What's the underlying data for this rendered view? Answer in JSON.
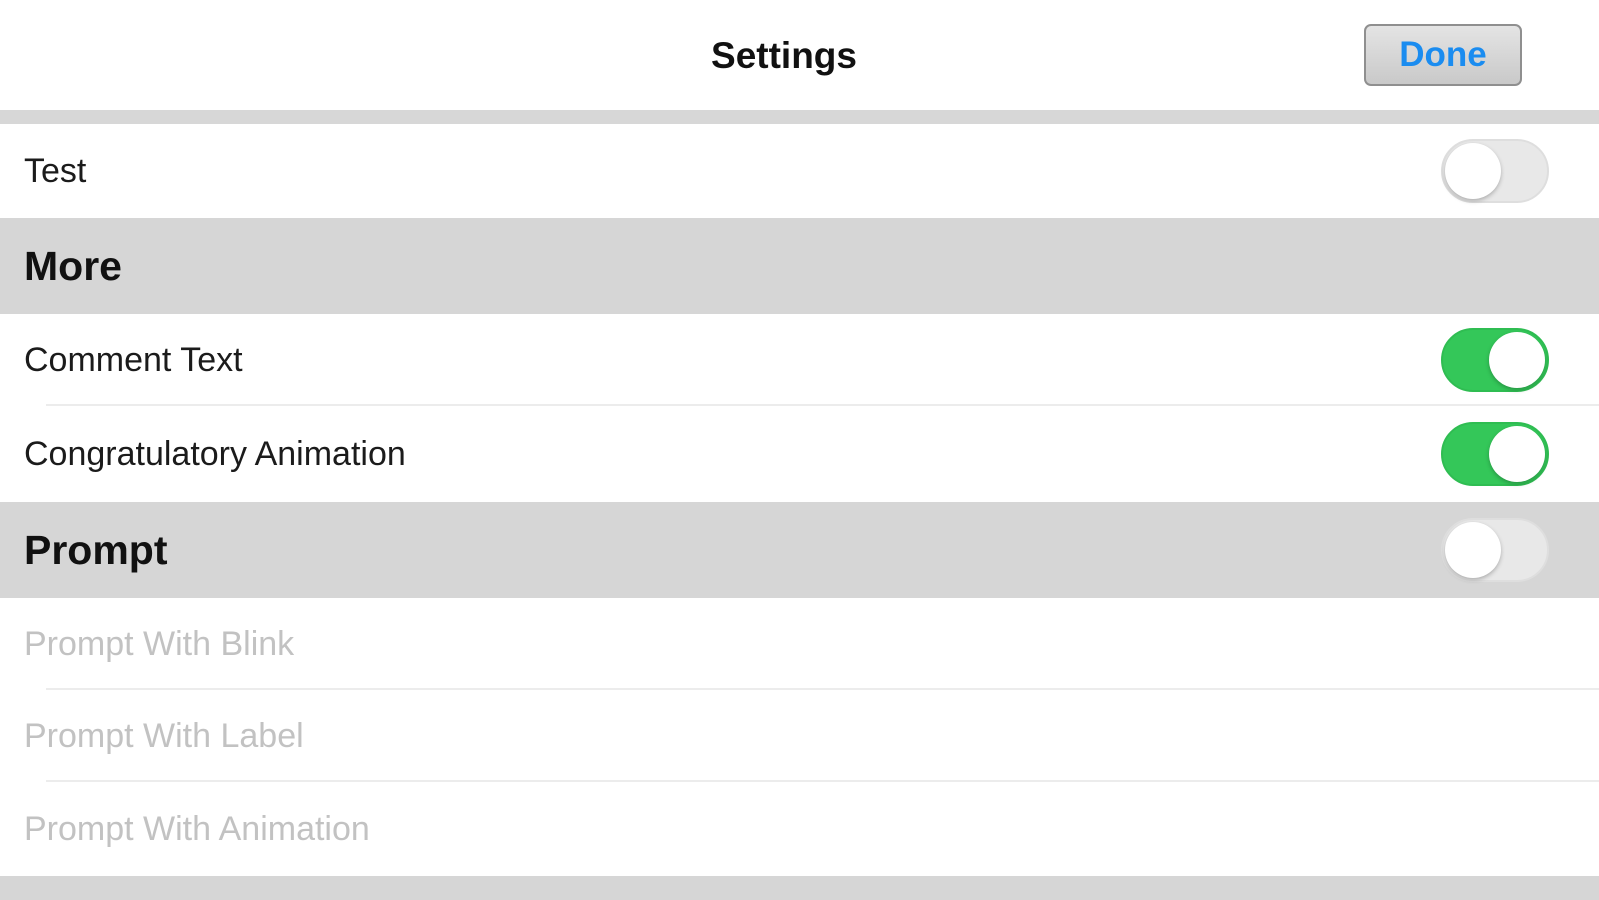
{
  "navbar": {
    "title": "Settings",
    "done_label": "Done"
  },
  "colors": {
    "accent": "#1a8cf0",
    "toggle_on": "#34c759",
    "section_header_bg": "#d6d6d6",
    "disabled_text": "#c2c2c2"
  },
  "rows": {
    "test": {
      "label": "Test",
      "toggle": "off"
    },
    "more_header": {
      "label": "More"
    },
    "comment_text": {
      "label": "Comment Text",
      "toggle": "on"
    },
    "congratulatory_animation": {
      "label": "Congratulatory Animation",
      "toggle": "on"
    },
    "prompt_header": {
      "label": "Prompt",
      "toggle": "off"
    },
    "prompt_with_blink": {
      "label": "Prompt With Blink",
      "enabled": false
    },
    "prompt_with_label": {
      "label": "Prompt With Label",
      "enabled": false
    },
    "prompt_with_animation": {
      "label": "Prompt With Animation",
      "enabled": false
    }
  }
}
